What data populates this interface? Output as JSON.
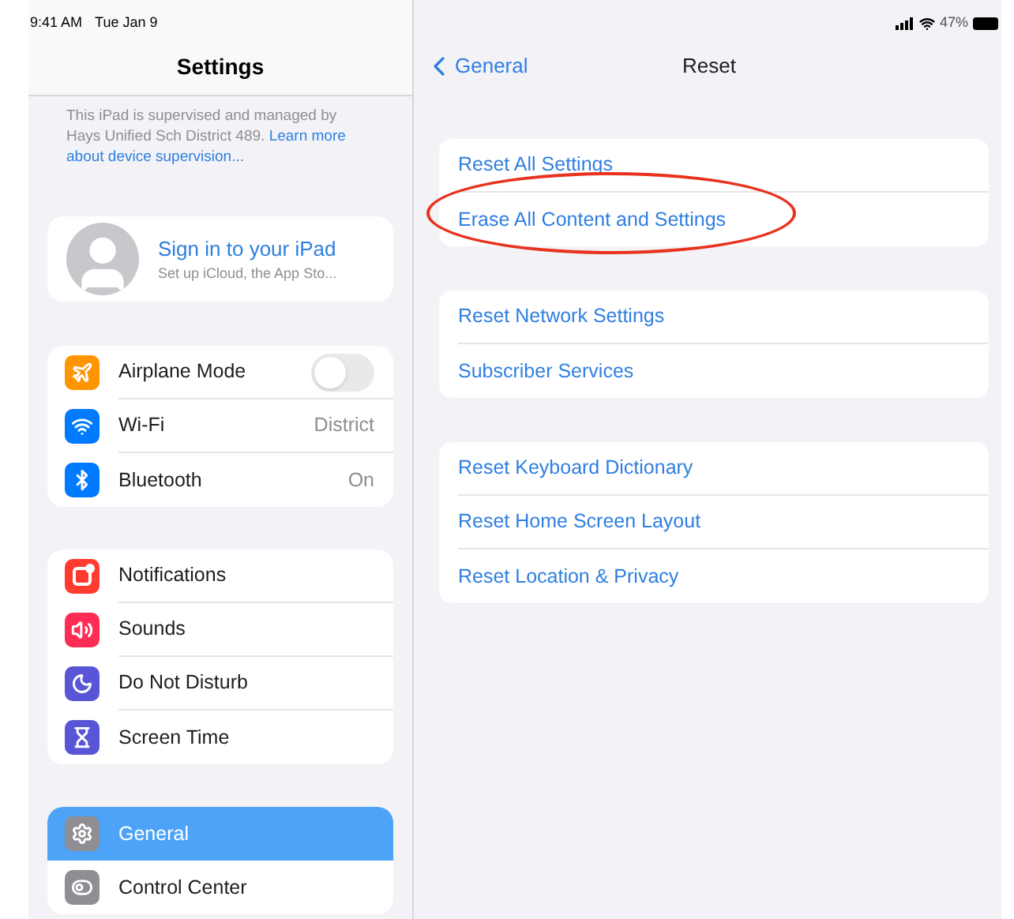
{
  "status_bar": {
    "time": "9:41 AM",
    "date": "Tue Jan 9",
    "battery": "47%"
  },
  "sidebar": {
    "title": "Settings",
    "supervision_text": "This iPad is supervised and managed by Hays Unified Sch District 489.",
    "supervision_link": "Learn more about device supervision...",
    "account": {
      "title": "Sign in to your iPad",
      "subtitle": "Set up iCloud, the App Sto..."
    },
    "groups": [
      [
        {
          "label": "Airplane Mode",
          "color": "#ff9500",
          "kind": "toggle",
          "on": false,
          "selected": false
        },
        {
          "label": "Wi-Fi",
          "color": "#007aff",
          "kind": "value",
          "value": "District",
          "selected": false
        },
        {
          "label": "Bluetooth",
          "color": "#007aff",
          "kind": "value",
          "value": "On",
          "selected": false
        }
      ],
      [
        {
          "label": "Notifications",
          "color": "#ff3b30",
          "kind": "plain",
          "selected": false
        },
        {
          "label": "Sounds",
          "color": "#ff2d55",
          "kind": "plain",
          "selected": false
        },
        {
          "label": "Do Not Disturb",
          "color": "#5856d6",
          "kind": "plain",
          "selected": false
        },
        {
          "label": "Screen Time",
          "color": "#5856d6",
          "kind": "plain",
          "selected": false
        }
      ],
      [
        {
          "label": "General",
          "color": "#8e8e93",
          "kind": "plain",
          "selected": true
        },
        {
          "label": "Control Center",
          "color": "#8e8e93",
          "kind": "plain",
          "selected": false
        }
      ]
    ]
  },
  "detail": {
    "back": "General",
    "title": "Reset",
    "groups": [
      [
        {
          "label": "Reset All Settings",
          "circled": false
        },
        {
          "label": "Erase All Content and Settings",
          "circled": true
        }
      ],
      [
        {
          "label": "Reset Network Settings",
          "circled": false
        },
        {
          "label": "Subscriber Services",
          "circled": false
        }
      ],
      [
        {
          "label": "Reset Keyboard Dictionary",
          "circled": false
        },
        {
          "label": "Reset Home Screen Layout",
          "circled": false
        },
        {
          "label": "Reset Location & Privacy",
          "circled": false
        }
      ]
    ]
  }
}
